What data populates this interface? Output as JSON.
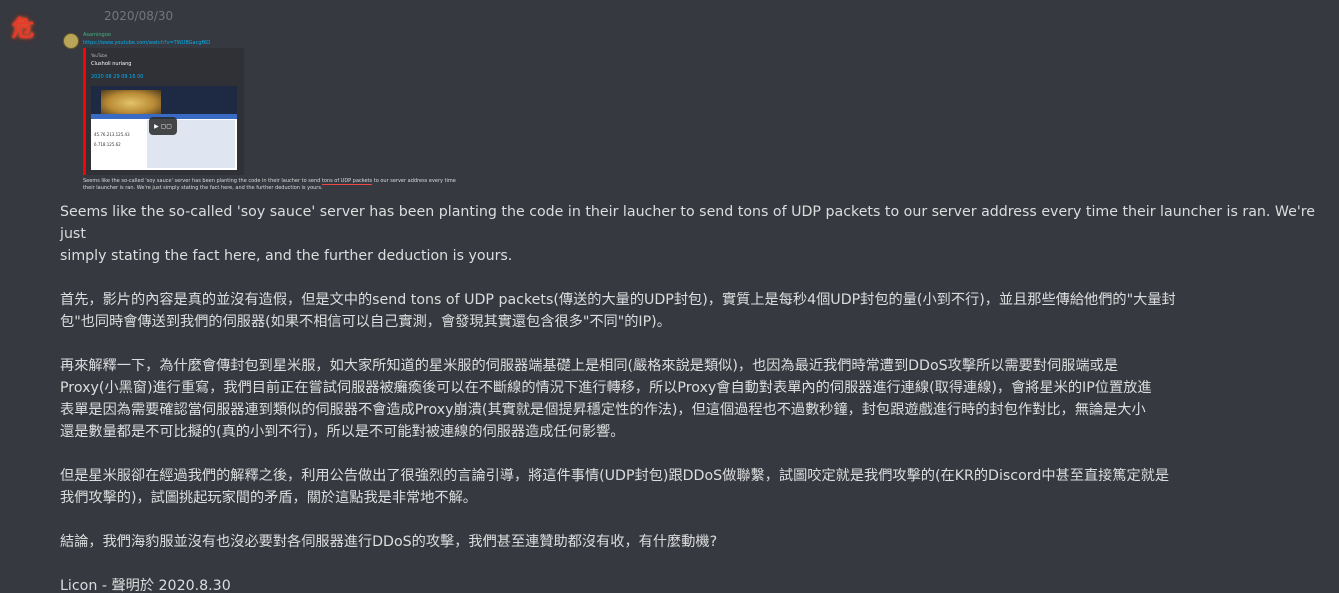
{
  "message": {
    "avatar_glyph": "危",
    "date": "2020/08/30",
    "embedded_screenshot": {
      "username": "Asamingoo",
      "time": "",
      "link": "https://www.youtube.com/watch?v=TWUBGacgfKO",
      "card": {
        "source": "YouTube",
        "channel": "Clusholi nuriang",
        "video_title": "2020 08 29 09 16 00",
        "ip_lines": [
          "45.76.213.125.43",
          "6.718.125.62"
        ],
        "play_glyph": "▶ ▢▢"
      },
      "caption_pre": "Seems like the so-called 'soy sauce' server has been planting the code in their laucher to send ",
      "caption_underlined": "tons of UDP packets",
      "caption_post": " to our server address every time their launcher is ran. We're just simply stating the fact here, and the further deduction is yours."
    },
    "paragraphs": [
      "Seems like the so-called 'soy sauce' server has been planting the code in their laucher to send tons of UDP packets to our server address every time their launcher is ran. We're just\nsimply stating the fact here, and the further deduction is yours.",
      "首先，影片的內容是真的並沒有造假，但是文中的send tons of UDP packets(傳送的大量的UDP封包)，實質上是每秒4個UDP封包的量(小到不行)，並且那些傳給他們的\"大量封\n包\"也同時會傳送到我們的伺服器(如果不相信可以自己實測，會發現其實還包含很多\"不同\"的IP)。",
      "再來解釋一下，為什麼會傳封包到星米服，如大家所知道的星米服的伺服器端基礎上是相同(嚴格來說是類似)，也因為最近我們時常遭到DDoS攻擊所以需要對伺服端或是\nProxy(小黑窗)進行重寫，我們目前正在嘗試伺服器被癱瘓後可以在不斷線的情況下進行轉移，所以Proxy會自動對表單內的伺服器進行連線(取得連線)，會將星米的IP位置放進\n表單是因為需要確認當伺服器連到類似的伺服器不會造成Proxy崩潰(其實就是個提昇穩定性的作法)，但這個過程也不過數秒鐘，封包跟遊戲進行時的封包作對比，無論是大小\n還是數量都是不可比擬的(真的小到不行)，所以是不可能對被連線的伺服器造成任何影響。",
      "但是星米服卻在經過我們的解釋之後，利用公告做出了很強烈的言論引導，將這件事情(UDP封包)跟DDoS做聯繫，試圖咬定就是我們攻擊的(在KR的Discord中甚至直接篤定就是\n我們攻擊的)，試圖挑起玩家間的矛盾，關於這點我是非常地不解。",
      "結論，我們海豹服並沒有也沒必要對各伺服器進行DDoS的攻擊，我們甚至連贊助都沒有收，有什麼動機?",
      "Licon - 聲明於 2020.8.30"
    ]
  }
}
